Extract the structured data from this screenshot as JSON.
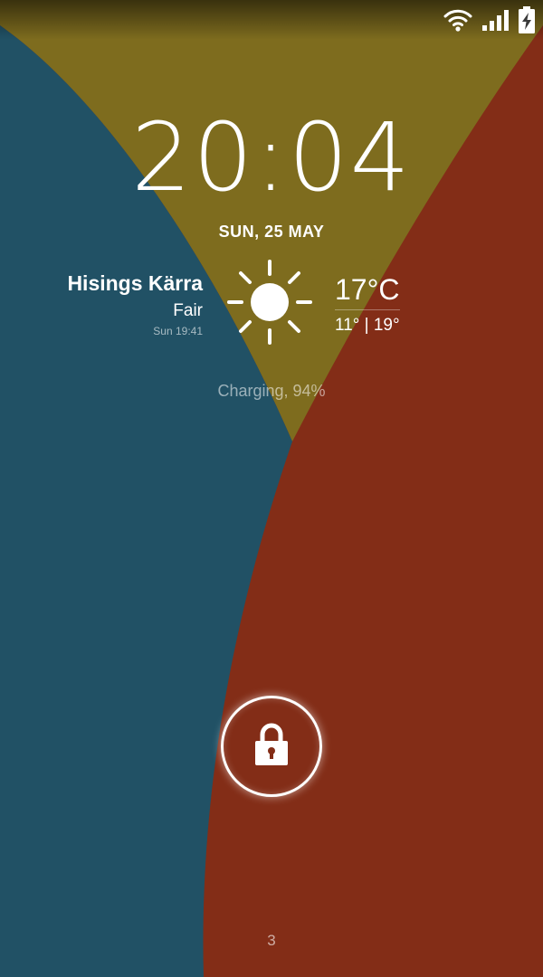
{
  "colors": {
    "blue": "#215165",
    "olive": "#7e6c1e",
    "rust": "#832d17"
  },
  "status_bar": {
    "icons": [
      "wifi-icon",
      "signal-icon",
      "battery-charging-icon"
    ]
  },
  "clock": {
    "time": "20:04",
    "date": "SUN, 25 MAY"
  },
  "weather": {
    "location": "Hisings Kärra",
    "condition": "Fair",
    "updated": "Sun 19:41",
    "icon": "sun-icon",
    "temperature": "17°C",
    "range": "11° | 19°"
  },
  "charging": "Charging, 94%",
  "lock": {
    "icon": "lock-icon"
  },
  "page_indicator": "3"
}
